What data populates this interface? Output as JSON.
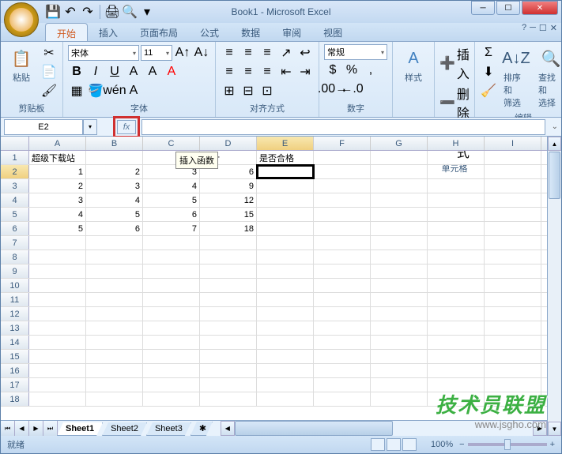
{
  "window": {
    "title": "Book1 - Microsoft Excel"
  },
  "qat_icons": [
    "save-icon",
    "undo-icon",
    "redo-icon",
    "print-icon",
    "preview-icon"
  ],
  "tabs": {
    "items": [
      "开始",
      "插入",
      "页面布局",
      "公式",
      "数据",
      "审阅",
      "视图"
    ],
    "active_index": 0
  },
  "ribbon": {
    "clipboard": {
      "label": "剪贴板",
      "paste": "粘贴"
    },
    "font": {
      "label": "字体",
      "name": "宋体",
      "size": "11"
    },
    "alignment": {
      "label": "对齐方式"
    },
    "number": {
      "label": "数字",
      "format": "常规"
    },
    "styles": {
      "label": "样式",
      "btn": "样式"
    },
    "cells": {
      "label": "单元格",
      "insert": "插入",
      "delete": "删除",
      "format": "格式"
    },
    "editing": {
      "label": "编辑",
      "sort": "排序和\n筛选",
      "find": "查找和\n选择"
    }
  },
  "formula_bar": {
    "name_box": "E2",
    "fx": "fx"
  },
  "tooltip": "插入函数",
  "columns": [
    "A",
    "B",
    "C",
    "D",
    "E",
    "F",
    "G",
    "H",
    "I"
  ],
  "selected_col": "E",
  "selected_row": 2,
  "row_count": 18,
  "data_rows": [
    {
      "r": 1,
      "cells": [
        "超级下载站",
        "",
        "",
        "合计",
        "是否合格"
      ]
    },
    {
      "r": 2,
      "cells": [
        "1",
        "2",
        "3",
        "6",
        ""
      ]
    },
    {
      "r": 3,
      "cells": [
        "2",
        "3",
        "4",
        "9",
        ""
      ]
    },
    {
      "r": 4,
      "cells": [
        "3",
        "4",
        "5",
        "12",
        ""
      ]
    },
    {
      "r": 5,
      "cells": [
        "4",
        "5",
        "6",
        "15",
        ""
      ]
    },
    {
      "r": 6,
      "cells": [
        "5",
        "6",
        "7",
        "18",
        ""
      ]
    }
  ],
  "sheets": {
    "items": [
      "Sheet1",
      "Sheet2",
      "Sheet3"
    ],
    "active_index": 0
  },
  "status": {
    "mode": "就绪",
    "zoom": "100%",
    "zoom_minus": "−",
    "zoom_plus": "+"
  },
  "watermark": {
    "line1": "技术员联盟",
    "line2": "www.jsgho.com"
  }
}
